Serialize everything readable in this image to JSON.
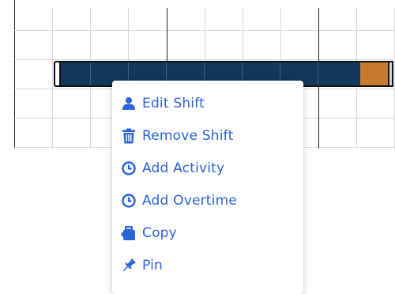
{
  "context_menu": {
    "items": [
      {
        "label": "Edit Shift",
        "icon": "user-icon"
      },
      {
        "label": "Remove Shift",
        "icon": "trash-icon"
      },
      {
        "label": "Add Activity",
        "icon": "clock-icon"
      },
      {
        "label": "Add Overtime",
        "icon": "clock-icon"
      },
      {
        "label": "Copy",
        "icon": "copy-icon"
      },
      {
        "label": "Pin",
        "icon": "pin-icon"
      }
    ]
  },
  "colors": {
    "shift_bar": "#11375a",
    "overtime": "#c57a30",
    "menu_text": "#2b63d9"
  }
}
